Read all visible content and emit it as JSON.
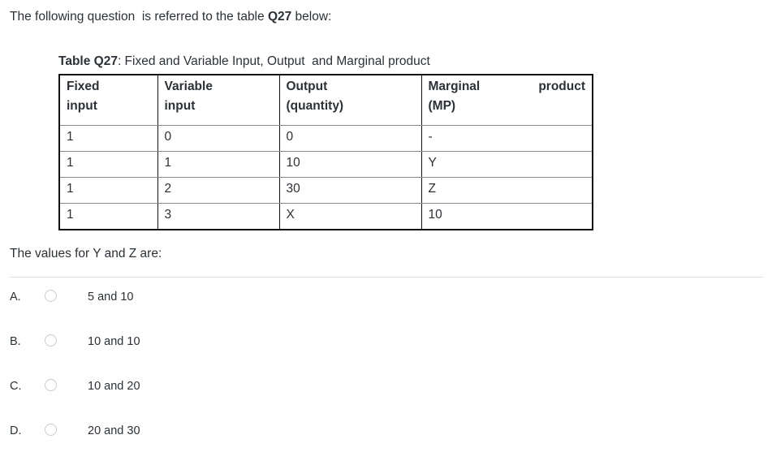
{
  "intro": {
    "prefix": "The following question  is referred to the table ",
    "strong": "Q27",
    "suffix": " below:"
  },
  "table": {
    "caption_strong": "Table Q27",
    "caption_rest": ": Fixed and Variable Input, Output  and Marginal product",
    "headers": [
      {
        "line1": "Fixed",
        "line2": "input"
      },
      {
        "line1": "Variable",
        "line2": "input"
      },
      {
        "line1": "Output",
        "line2": "(quantity)"
      },
      {
        "line1a": "Marginal",
        "line1b": "product",
        "line2": "(MP)"
      }
    ],
    "rows": [
      {
        "fixed_input": "1",
        "variable_input": "0",
        "output": "0",
        "mp": "-"
      },
      {
        "fixed_input": "1",
        "variable_input": "1",
        "output": "10",
        "mp": "Y"
      },
      {
        "fixed_input": "1",
        "variable_input": "2",
        "output": "30",
        "mp": "Z"
      },
      {
        "fixed_input": "1",
        "variable_input": "3",
        "output": "X",
        "mp": "10"
      }
    ]
  },
  "question": {
    "prompt": "The values for Y and Z are:"
  },
  "options": [
    {
      "letter": "A.",
      "text": "5 and 10"
    },
    {
      "letter": "B.",
      "text": "10 and 10"
    },
    {
      "letter": "C.",
      "text": "10 and 20"
    },
    {
      "letter": "D.",
      "text": "20 and 30"
    }
  ],
  "colors": {
    "text": "#2b3137",
    "table_border": "#111111",
    "row_line": "#8a8f94",
    "divider": "#dcdfe2",
    "radio_border": "#c7ccd1",
    "background": "#ffffff"
  }
}
